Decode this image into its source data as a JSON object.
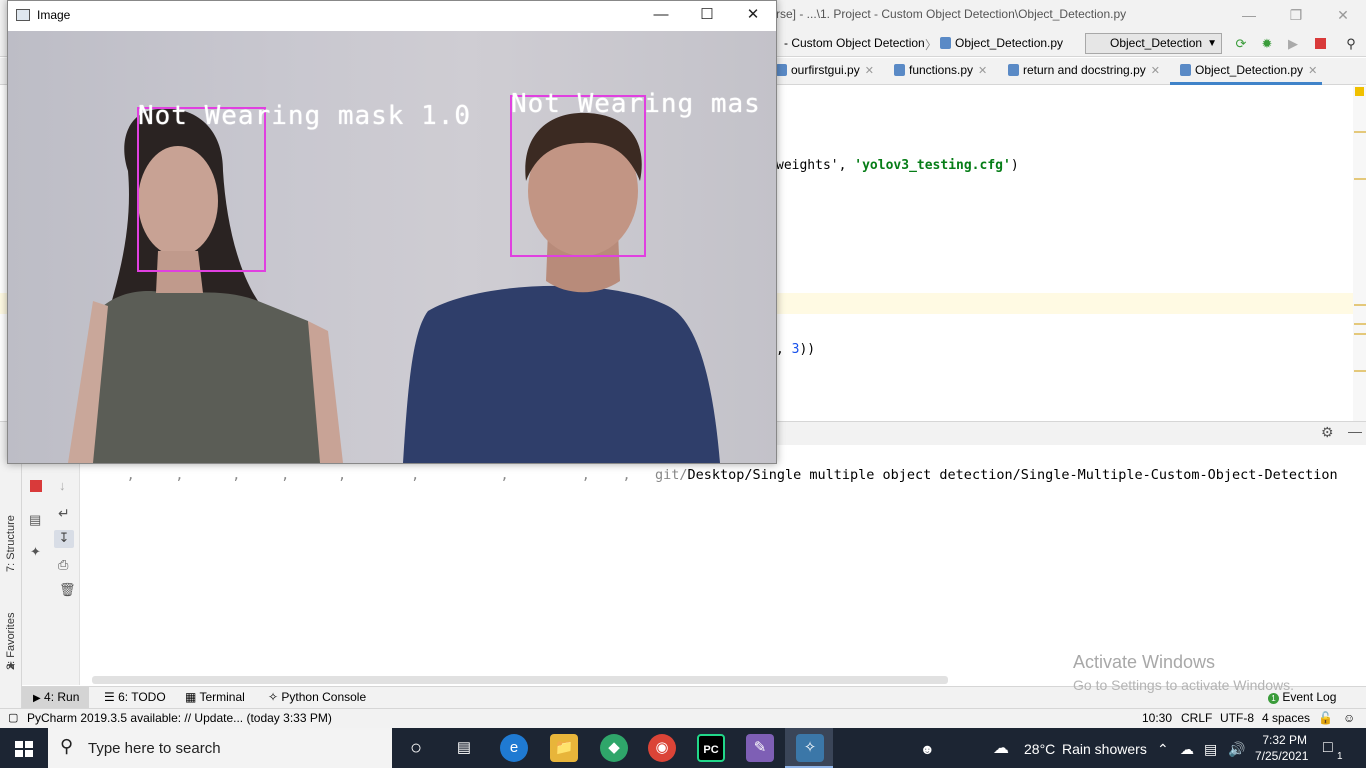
{
  "pycharm": {
    "title": "rse] - ...\\1. Project - Custom Object Detection\\Object_Detection.py",
    "breadcrumb_project": "- Custom Object Detection",
    "breadcrumb_sep": "〉",
    "breadcrumb_file": "Object_Detection.py",
    "run_config": "Object_Detection",
    "tabs": [
      {
        "label": "ourfirstgui.py"
      },
      {
        "label": "functions.py"
      },
      {
        "label": "return and docstring.py"
      },
      {
        "label": "Object_Detection.py"
      }
    ],
    "code_line1_a": "weights', ",
    "code_line1_str": "'yolov3_testing.cfg'",
    "code_line1_b": ")",
    "code_line2_a": ", ",
    "code_line2_num": "3",
    "code_line2_b": "))",
    "console_line": "Desktop/Single multiple object detection/Single-Multiple-Custom-Object-Detection",
    "left_labels": [
      "7: Structure",
      "2: Favorites"
    ],
    "bottom_tabs": [
      "4: Run",
      "6: TODO",
      "Terminal",
      "Python Console"
    ],
    "event_log": "Event Log",
    "status_left": "PyCharm 2019.3.5 available: // Update... (today 3:33 PM)",
    "status_pos": "10:30",
    "status_eol": "CRLF",
    "status_enc": "UTF-8",
    "status_indent": "4 spaces",
    "activate_title": "Activate Windows",
    "activate_sub": "Go to Settings to activate Windows."
  },
  "image_window": {
    "title": "Image",
    "detections": [
      {
        "label": "Not Wearing mask 1.0"
      },
      {
        "label": "Not Wearing mas"
      }
    ]
  },
  "taskbar": {
    "search_placeholder": "Type here to search",
    "weather_temp": "28°C",
    "weather_text": "Rain showers",
    "time": "7:32 PM",
    "date": "7/25/2021",
    "notifications": "1"
  }
}
